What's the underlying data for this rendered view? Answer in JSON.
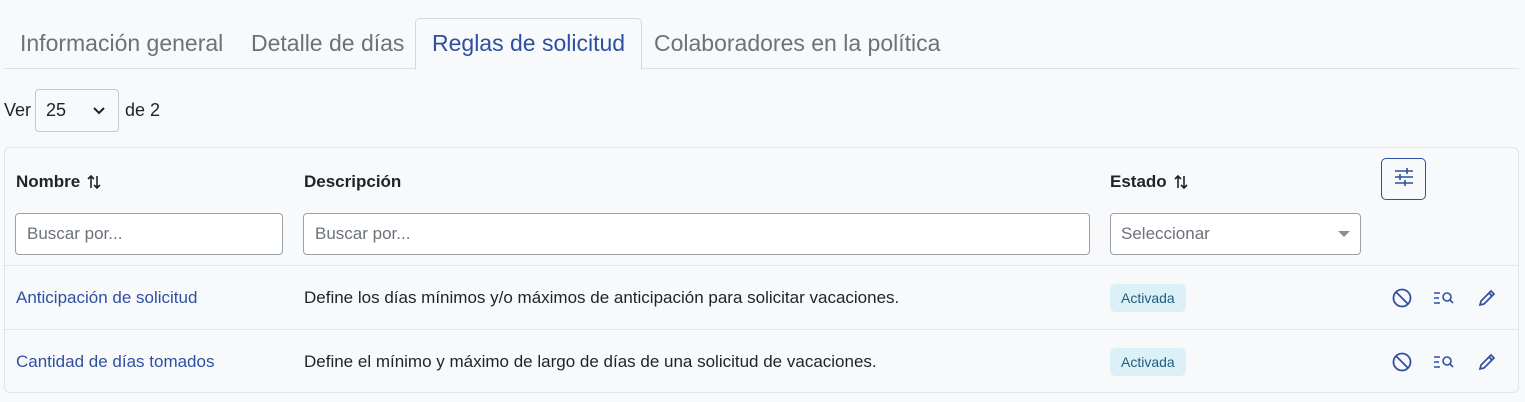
{
  "tabs": [
    {
      "label": "Información general"
    },
    {
      "label": "Detalle de días"
    },
    {
      "label": "Reglas de solicitud"
    },
    {
      "label": "Colaboradores en la política"
    }
  ],
  "pager": {
    "prefix": "Ver",
    "value": "25",
    "suffix": "de 2"
  },
  "table": {
    "headers": {
      "name": "Nombre",
      "description": "Descripción",
      "status": "Estado"
    },
    "filters": {
      "name_placeholder": "Buscar por...",
      "description_placeholder": "Buscar por...",
      "status_placeholder": "Seleccionar"
    },
    "rows": [
      {
        "name": "Anticipación de solicitud",
        "description": "Define los días mínimos y/o máximos de anticipación para solicitar vacaciones.",
        "status": "Activada"
      },
      {
        "name": "Cantidad de días tomados",
        "description": "Define el mínimo y máximo de largo de días de una solicitud de vacaciones.",
        "status": "Activada"
      }
    ]
  },
  "colors": {
    "accent": "#2f4fa0",
    "badge_bg": "#dcf0f8",
    "badge_text": "#1c5f7d"
  },
  "icons": [
    "sort-icon",
    "chevron-down-icon",
    "sliders-icon",
    "disable-icon",
    "view-details-icon",
    "edit-icon"
  ]
}
